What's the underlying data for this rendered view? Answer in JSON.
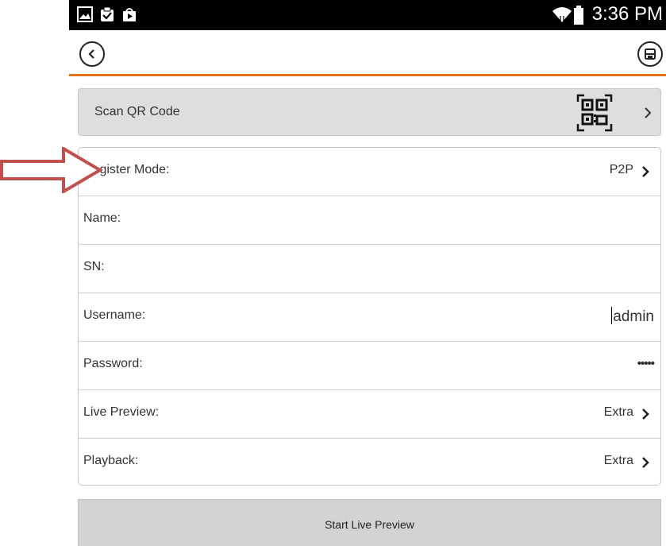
{
  "status_bar": {
    "time": "3:36 PM",
    "icons": [
      "gallery-icon",
      "clipboard-check-icon",
      "play-store-icon",
      "wifi-icon",
      "battery-icon"
    ]
  },
  "header": {
    "back_icon": "back-icon",
    "save_icon": "save-icon",
    "accent_color": "#e8731f"
  },
  "scan_qr": {
    "label": "Scan QR Code",
    "icon": "qr-code-icon"
  },
  "form": {
    "rows": [
      {
        "label": "Register Mode:",
        "value": "P2P"
      },
      {
        "label": "Name:",
        "value": ""
      },
      {
        "label": "SN:",
        "value": ""
      },
      {
        "label": "Username:",
        "value": "admin"
      },
      {
        "label": "Password:",
        "value": "•••••"
      },
      {
        "label": "Live Preview:",
        "value": "Extra"
      },
      {
        "label": "Playback:",
        "value": "Extra"
      }
    ]
  },
  "start_button": {
    "label": "Start Live Preview"
  },
  "annotation": {
    "color": "#c0504d"
  }
}
